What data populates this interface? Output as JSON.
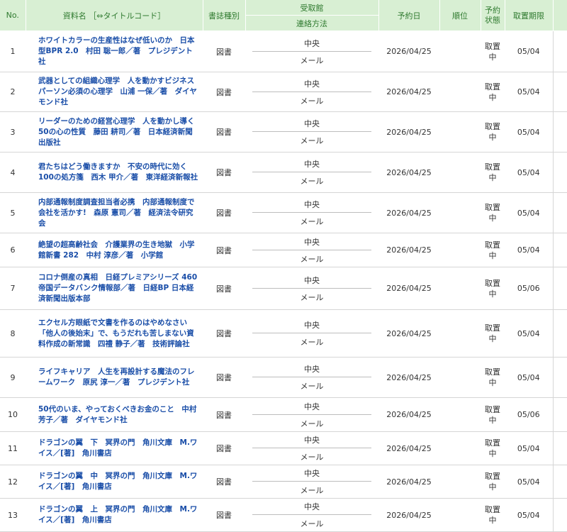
{
  "header": {
    "no": "No.",
    "title": "資料名 ［⇔タイトルコード］",
    "type": "書誌種別",
    "branch": "受取館",
    "contact": "連絡方法",
    "date": "予約日",
    "rank": "順位",
    "state": "予約状態",
    "limit": "取置期限"
  },
  "rows": [
    {
      "no": "1",
      "title": "ホワイトカラーの生産性はなぜ低いのか　日本型BPR 2.0　村田 聡一郎／著　プレジデント社",
      "type": "図書",
      "branch": "中央",
      "contact": "メール",
      "date": "2026/04/25",
      "rank": "",
      "state": "取置中",
      "limit": "05/04"
    },
    {
      "no": "2",
      "title": "武器としての組織心理学　人を動かすビジネスパーソン必須の心理学　山浦 一保／著　ダイヤモンド社",
      "type": "図書",
      "branch": "中央",
      "contact": "メール",
      "date": "2026/04/25",
      "rank": "",
      "state": "取置中",
      "limit": "05/04"
    },
    {
      "no": "3",
      "title": "リーダーのための経営心理学　人を動かし導く50の心の性質　藤田 耕司／著　日本経済新聞出版社",
      "type": "図書",
      "branch": "中央",
      "contact": "メール",
      "date": "2026/04/25",
      "rank": "",
      "state": "取置中",
      "limit": "05/04"
    },
    {
      "no": "4",
      "title": "君たちはどう働きますか　不安の時代に効く100の処方箋　西木 甲介／著　東洋経済新報社",
      "type": "図書",
      "branch": "中央",
      "contact": "メール",
      "date": "2026/04/25",
      "rank": "",
      "state": "取置中",
      "limit": "05/04"
    },
    {
      "no": "5",
      "title": "内部通報制度調査担当者必携　内部通報制度で会社を活かす!　森原 憲司／著　経済法令研究会",
      "type": "図書",
      "branch": "中央",
      "contact": "メール",
      "date": "2026/04/25",
      "rank": "",
      "state": "取置中",
      "limit": "05/04"
    },
    {
      "no": "6",
      "title": "絶望の超高齢社会　介護業界の生き地獄　小学館新書 282　中村 淳彦／著　小学館",
      "type": "図書",
      "branch": "中央",
      "contact": "メール",
      "date": "2026/04/25",
      "rank": "",
      "state": "取置中",
      "limit": "05/04"
    },
    {
      "no": "7",
      "title": "コロナ倒産の真相　日経プレミアシリーズ 460　帝国データバンク情報部／著　日経BP 日本経済新聞出版本部",
      "type": "図書",
      "branch": "中央",
      "contact": "メール",
      "date": "2026/04/25",
      "rank": "",
      "state": "取置中",
      "limit": "05/06"
    },
    {
      "no": "8",
      "title": "エクセル方眼紙で文書を作るのはやめなさい　「他人の後始末」で、もうだれも苦しまない資料作成の新常識　四禮 静子／著　技術評論社",
      "type": "図書",
      "branch": "中央",
      "contact": "メール",
      "date": "2026/04/25",
      "rank": "",
      "state": "取置中",
      "limit": "05/04"
    },
    {
      "no": "9",
      "title": "ライフキャリア　人生を再設計する魔法のフレームワーク　原尻 淳一／著　プレジデント社",
      "type": "図書",
      "branch": "中央",
      "contact": "メール",
      "date": "2026/04/25",
      "rank": "",
      "state": "取置中",
      "limit": "05/04"
    },
    {
      "no": "10",
      "title": "50代のいま、やっておくべきお金のこと　中村 芳子／著　ダイヤモンド社",
      "type": "図書",
      "branch": "中央",
      "contact": "メール",
      "date": "2026/04/25",
      "rank": "",
      "state": "取置中",
      "limit": "05/06"
    },
    {
      "no": "11",
      "title": "ドラゴンの翼　下　冥界の門　角川文庫　M.ワイス／[著]　角川書店",
      "type": "図書",
      "branch": "中央",
      "contact": "メール",
      "date": "2026/04/25",
      "rank": "",
      "state": "取置中",
      "limit": "05/04"
    },
    {
      "no": "12",
      "title": "ドラゴンの翼　中　冥界の門　角川文庫　M.ワイス／[著]　角川書店",
      "type": "図書",
      "branch": "中央",
      "contact": "メール",
      "date": "2026/04/25",
      "rank": "",
      "state": "取置中",
      "limit": "05/04"
    },
    {
      "no": "13",
      "title": "ドラゴンの翼　上　冥界の門　角川文庫　M.ワイス／[著]　角川書店",
      "type": "図書",
      "branch": "中央",
      "contact": "メール",
      "date": "2026/04/25",
      "rank": "",
      "state": "取置中",
      "limit": "05/04"
    }
  ]
}
